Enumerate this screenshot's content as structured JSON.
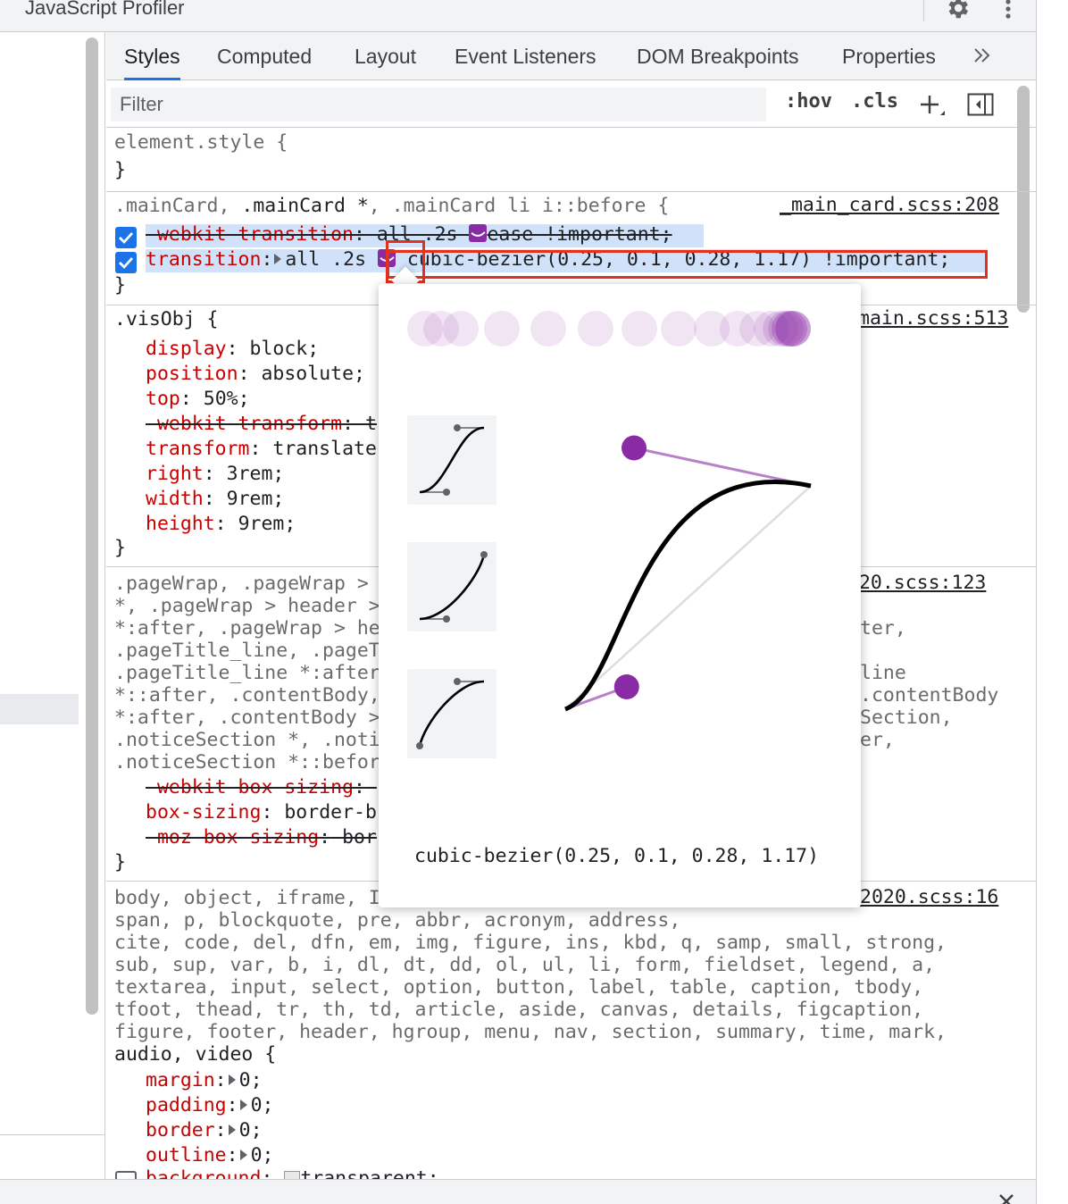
{
  "window": {
    "title": "JavaScript Profiler"
  },
  "tabs": [
    {
      "label": "Styles",
      "active": true
    },
    {
      "label": "Computed"
    },
    {
      "label": "Layout"
    },
    {
      "label": "Event Listeners"
    },
    {
      "label": "DOM Breakpoints"
    },
    {
      "label": "Properties"
    }
  ],
  "filter": {
    "placeholder": "Filter",
    "hov": ":hov",
    "cls": ".cls"
  },
  "rules": {
    "element_style": {
      "selector": "element.style {",
      "close": "}"
    },
    "maincard": {
      "sel_a": ".mainCard, ",
      "sel_b": ".mainCard *",
      "sel_c": ", .mainCard li i::before {",
      "source": "_main_card.scss:208",
      "webkit_prop": "-webkit-transition",
      "webkit_val_a": "all .2s ",
      "webkit_val_b": "ease !important;",
      "prop": "transition",
      "val_a": "all .2s ",
      "val_b": "cubic-bezier(0.25, 0.1, 0.28, 1.17) !important;",
      "close": "}"
    },
    "visobj": {
      "selector": ".visObj {",
      "source": "main.scss:513",
      "decls": [
        {
          "prop": "display",
          "val": "block;"
        },
        {
          "prop": "position",
          "val": "absolute;"
        },
        {
          "prop": "top",
          "val": "50%;"
        },
        {
          "prop": "-webkit-transform",
          "val": "t",
          "strike": true
        },
        {
          "prop": "transform",
          "val": "translate"
        },
        {
          "prop": "right",
          "val": "3rem;"
        },
        {
          "prop": "width",
          "val": "9rem;"
        },
        {
          "prop": "height",
          "val": "9rem;"
        }
      ],
      "close": "}"
    },
    "pagewrap": {
      "source": "…20.scss:123",
      "lines_left": [
        ".pageWrap, .pageWrap >",
        "*, .pageWrap > header >",
        "*:after, .pageWrap > he",
        ".pageTitle_line, .pageT",
        ".pageTitle_line *:after",
        "*::after, .contentBody,",
        "*:after, .contentBody >",
        ".noticeSection *, .noti",
        ".noticeSection *::befor"
      ],
      "lines_right": [
        "",
        "",
        "ter,",
        "",
        "line",
        ".contentBody",
        "Section,",
        "er,",
        ""
      ],
      "decls": [
        {
          "prop": "-webkit-box-sizing",
          "val": "",
          "strike": true
        },
        {
          "prop": "box-sizing",
          "val": "border-b"
        },
        {
          "prop": "-moz-box-sizing",
          "val": "bor",
          "strike": true
        }
      ],
      "close": "}"
    },
    "body": {
      "source": "2020.scss:16",
      "lines": [
        "body, object, iframe, I",
        "span, p, blockquote, pre, abbr, acronym, address,",
        "cite, code, del, dfn, em, img, figure, ins, kbd, q, samp, small, strong,",
        "sub, sup, var, b, i, dl, dt, dd, ol, ul, li, form, fieldset, legend, a,",
        "textarea, input, select, option, button, label, table, caption, tbody,",
        "tfoot, thead, tr, th, td, article, aside, canvas, details, figcaption,",
        "figure, footer, header, hgroup, menu, nav, section, summary, time, mark,",
        "audio, video {"
      ],
      "decls": [
        {
          "prop": "margin",
          "val": "0;"
        },
        {
          "prop": "padding",
          "val": "0;"
        },
        {
          "prop": "border",
          "val": "0;"
        },
        {
          "prop": "outline",
          "val": "0;"
        }
      ],
      "partial_prop": "background",
      "partial_val": "transparent;"
    }
  },
  "bezier_editor": {
    "value": "cubic-bezier(0.25, 0.1, 0.28, 1.17)",
    "control_points": [
      0.25,
      0.1,
      0.28,
      1.17
    ],
    "accent_color": "#8a2ba6"
  },
  "icons": [
    "gear-icon",
    "kebab-menu-icon",
    "more-tabs-icon",
    "plus-icon",
    "sidebar-toggle-icon",
    "close-icon",
    "bezier-swatch-icon",
    "expand-triangle-icon"
  ]
}
